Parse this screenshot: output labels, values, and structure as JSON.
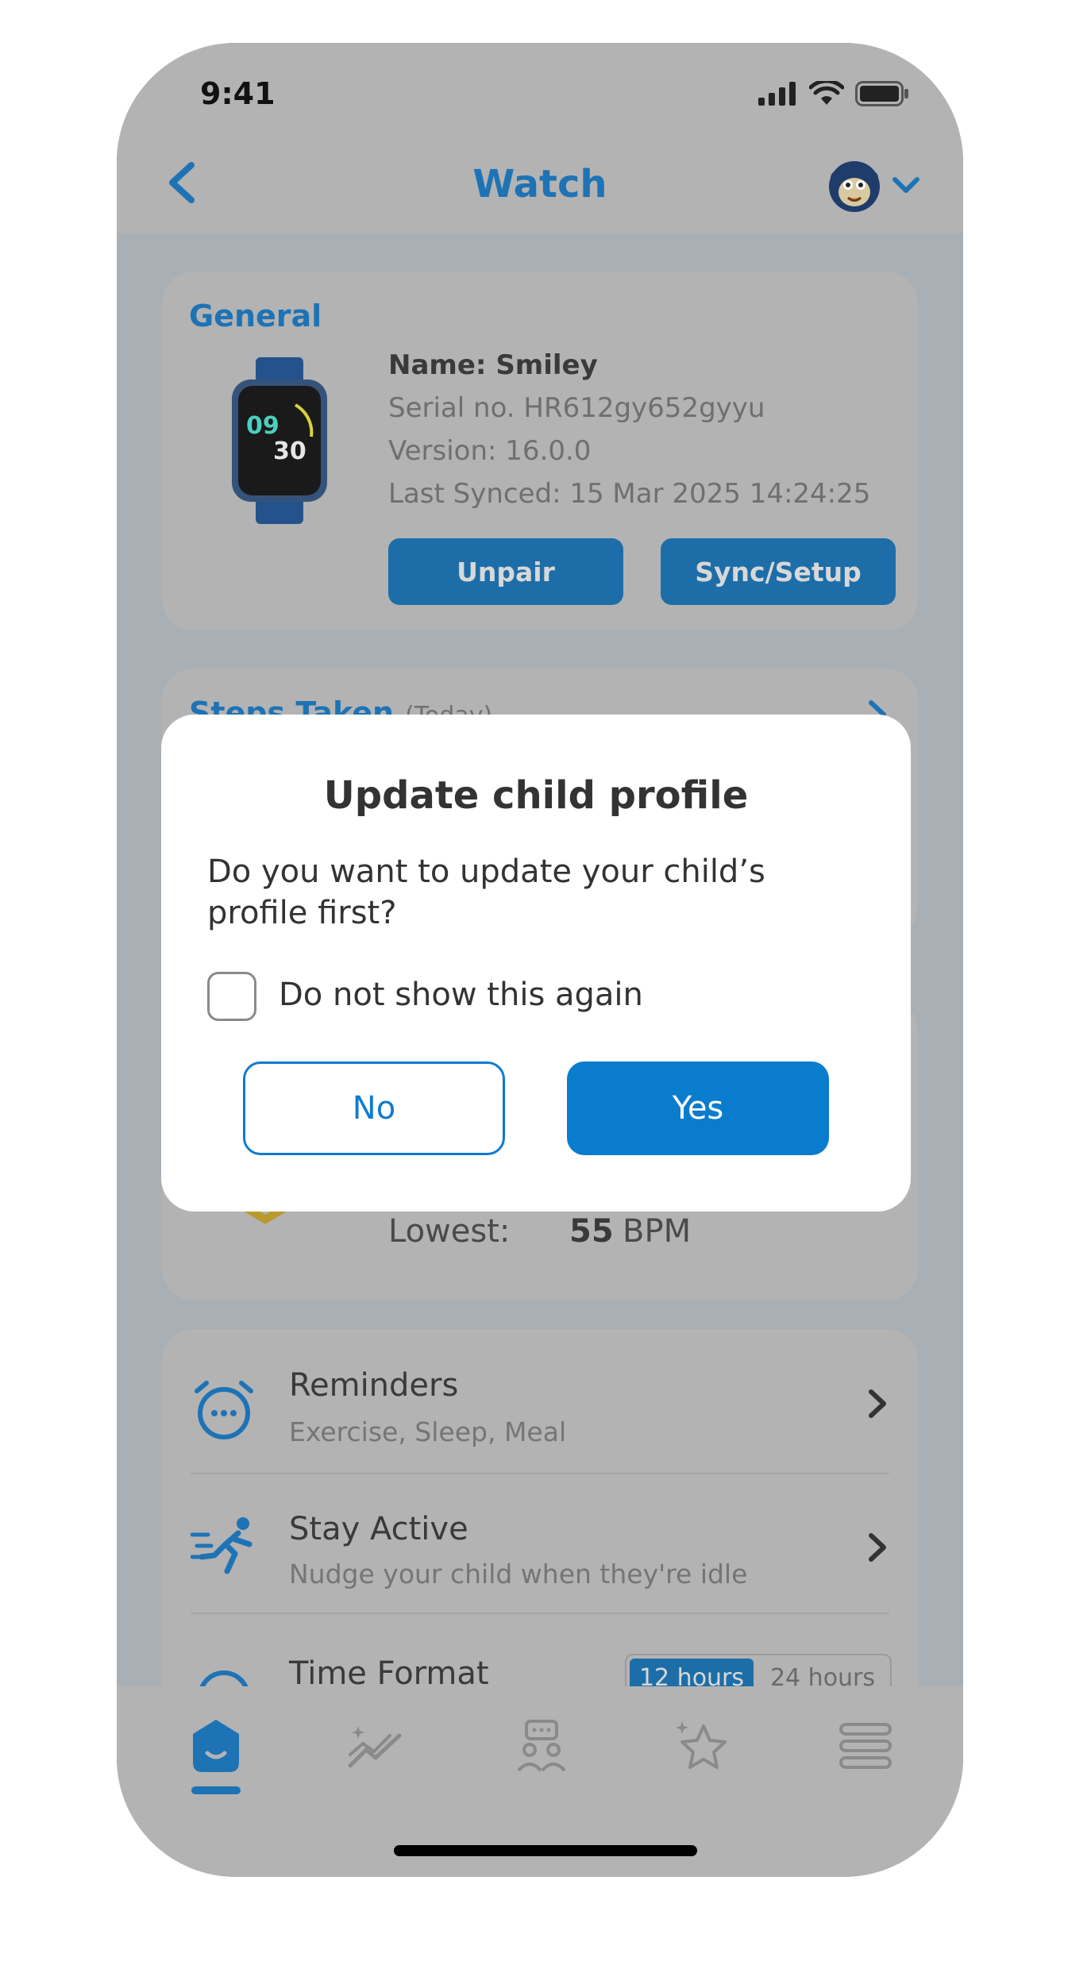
{
  "status_bar": {
    "time": "9:41"
  },
  "header": {
    "title": "Watch",
    "back_icon": "chevron-left-icon",
    "avatar_icon": "monkey-avatar-icon",
    "dropdown_icon": "chevron-down-icon"
  },
  "general": {
    "title": "General",
    "name": "Name: Smiley",
    "serial": "Serial no. HR612gy652gyyu",
    "version": "Version: 16.0.0",
    "last_synced": "Last Synced: 15 Mar 2025 14:24:25",
    "watch_face_hour": "09",
    "watch_face_minute": "30",
    "unpair_label": "Unpair",
    "sync_label": "Sync/Setup"
  },
  "steps": {
    "title": "Steps Taken",
    "subtitle": "(Today)"
  },
  "heart_rate": {
    "lowest_label": "Lowest:",
    "lowest_value": "55",
    "unit": "BPM"
  },
  "settings_list": [
    {
      "title": "Reminders",
      "subtitle": "Exercise, Sleep, Meal",
      "icon": "alarm-clock-icon"
    },
    {
      "title": "Stay Active",
      "subtitle": "Nudge your child when they're idle",
      "icon": "running-person-icon"
    },
    {
      "title": "Time Format",
      "options": [
        "12 hours",
        "24 hours"
      ],
      "selected": "12 hours"
    }
  ],
  "tabs": [
    {
      "icon": "home-icon",
      "active": true
    },
    {
      "icon": "activity-icon",
      "active": false
    },
    {
      "icon": "chat-people-icon",
      "active": false
    },
    {
      "icon": "star-icon",
      "active": false
    },
    {
      "icon": "menu-icon",
      "active": false
    }
  ],
  "dialog": {
    "title": "Update child profile",
    "body": "Do you want to update your child’s profile first?",
    "checkbox_label": "Do not show this again",
    "checkbox_checked": false,
    "no_label": "No",
    "yes_label": "Yes"
  },
  "colors": {
    "accent": "#0a7ccd",
    "title_blue": "#1e73b5",
    "overlay": "#b3b3b3"
  }
}
